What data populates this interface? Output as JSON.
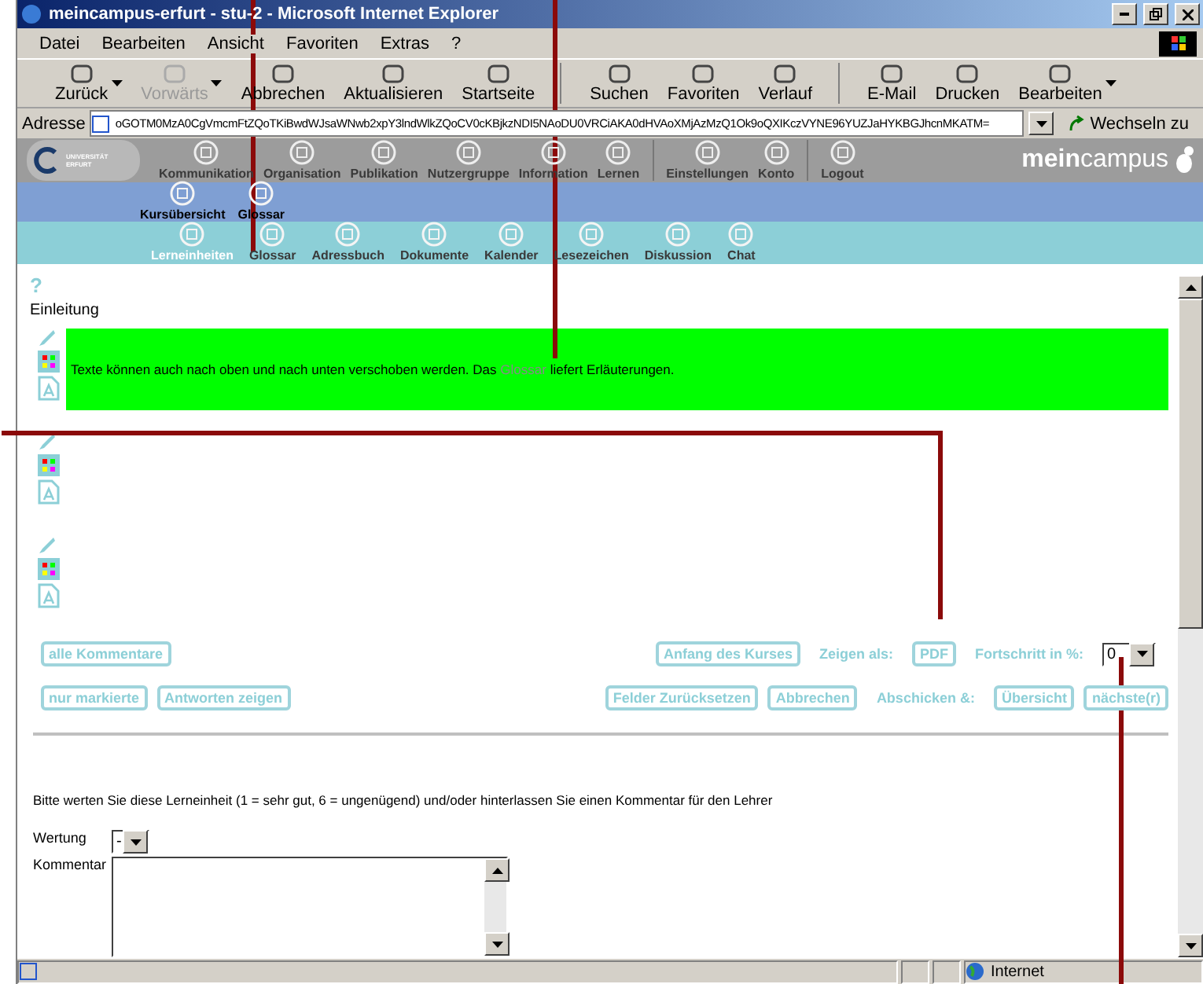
{
  "window": {
    "title": "meincampus-erfurt - stu-2 - Microsoft Internet Explorer"
  },
  "menu": [
    "Datei",
    "Bearbeiten",
    "Ansicht",
    "Favoriten",
    "Extras",
    "?"
  ],
  "toolbar": [
    [
      {
        "label": "Zurück",
        "disabled": false,
        "dropdown": true
      },
      {
        "label": "Vorwärts",
        "disabled": true,
        "dropdown": true
      },
      {
        "label": "Abbrechen",
        "disabled": false,
        "dropdown": false
      },
      {
        "label": "Aktualisieren",
        "disabled": false,
        "dropdown": false
      },
      {
        "label": "Startseite",
        "disabled": false,
        "dropdown": false
      }
    ],
    [
      {
        "label": "Suchen",
        "disabled": false,
        "dropdown": false
      },
      {
        "label": "Favoriten",
        "disabled": false,
        "dropdown": false
      },
      {
        "label": "Verlauf",
        "disabled": false,
        "dropdown": false
      }
    ],
    [
      {
        "label": "E-Mail",
        "disabled": false,
        "dropdown": false
      },
      {
        "label": "Drucken",
        "disabled": false,
        "dropdown": false
      },
      {
        "label": "Bearbeiten",
        "disabled": false,
        "dropdown": true
      }
    ]
  ],
  "address": {
    "label": "Adresse",
    "url": "oGOTM0MzA0CgVmcmFtZQoTKiBwdWJsaWNwb2xpY3lndWlkZQoCV0cKBjkzNDI5NAoDU0VRCiAKA0dHVAoXMjAzMzQ1Ok9oQXIKczVYNE96YUZJaHYKBGJhcnMKATM=",
    "go": "Wechseln zu"
  },
  "site": {
    "logo_lines": [
      "UNIVERSITÄT",
      "ERFURT"
    ],
    "brand_bold": "mein",
    "brand": "campus",
    "main_nav": [
      {
        "items": [
          "Kommunikation",
          "Organisation",
          "Publikation",
          "Nutzergruppe",
          "Information",
          "Lernen"
        ]
      },
      {
        "items": [
          "Einstellungen",
          "Konto"
        ]
      },
      {
        "items": [
          "Logout"
        ]
      }
    ],
    "sub_nav": [
      "Kursübersicht",
      "Glossar"
    ],
    "course_nav": [
      {
        "label": "Lerneinheiten",
        "selected": true
      },
      {
        "label": "Glossar",
        "selected": false
      },
      {
        "label": "Adressbuch",
        "selected": false
      },
      {
        "label": "Dokumente",
        "selected": false
      },
      {
        "label": "Kalender",
        "selected": false
      },
      {
        "label": "Lesezeichen",
        "selected": false
      },
      {
        "label": "Diskussion",
        "selected": false
      },
      {
        "label": "Chat",
        "selected": false
      }
    ]
  },
  "content": {
    "help": "?",
    "heading": "Einleitung",
    "blocks": [
      {
        "highlighted": true,
        "text": "Texte können auch nach oben und nach unten verschoben werden. Das",
        "link": "Glossar",
        "text_after": "liefert Erläuterungen."
      },
      {
        "highlighted": false
      },
      {
        "highlighted": false
      }
    ],
    "buttons_left_1": [
      "alle Kommentare"
    ],
    "course_start": "Anfang des Kurses",
    "show_as": "Zeigen als:",
    "pdf": "PDF",
    "progress_label": "Fortschritt in %:",
    "progress": "0",
    "buttons_left_2": [
      "nur markierte",
      "Antworten zeigen"
    ],
    "reset": "Felder Zurücksetzen",
    "cancel": "Abbrechen",
    "submit_label": "Abschicken &:",
    "submit_buttons": [
      "Übersicht",
      "nächste(r)"
    ],
    "rating_prompt": "Bitte werten Sie diese Lerneinheit (1 = sehr gut, 6 = ungenügend) und/oder hinterlassen Sie einen Kommentar für den Lehrer",
    "rating_label": "Wertung",
    "rating": "-",
    "comment_label": "Kommentar"
  },
  "status_bar": {
    "zone": "Internet"
  }
}
